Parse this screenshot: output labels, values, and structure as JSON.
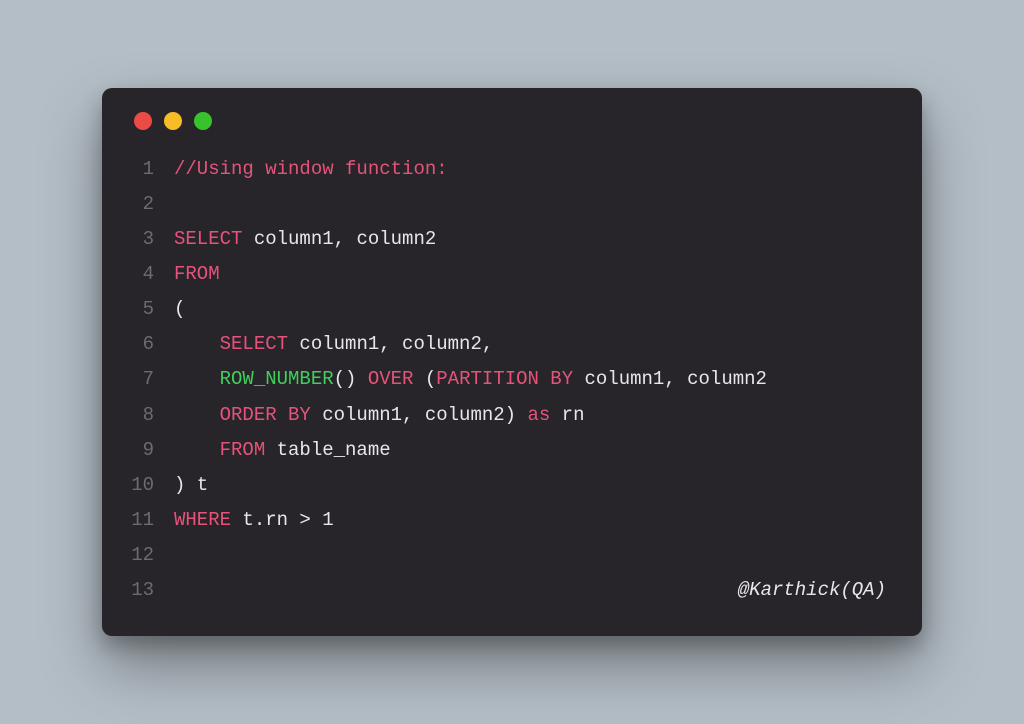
{
  "colors": {
    "close": "#eb4b45",
    "minimize": "#f6bd27",
    "zoom": "#38c22b"
  },
  "credit": "@Karthick(QA)",
  "lines": [
    {
      "n": "1",
      "tokens": [
        {
          "t": "//Using window function:",
          "c": "c-comment"
        }
      ]
    },
    {
      "n": "2",
      "tokens": []
    },
    {
      "n": "3",
      "tokens": [
        {
          "t": "SELECT",
          "c": "c-keyword"
        },
        {
          "t": " column1, column2",
          "c": "c-plain"
        }
      ]
    },
    {
      "n": "4",
      "tokens": [
        {
          "t": "FROM",
          "c": "c-keyword"
        }
      ]
    },
    {
      "n": "5",
      "tokens": [
        {
          "t": "(",
          "c": "c-plain"
        }
      ]
    },
    {
      "n": "6",
      "tokens": [
        {
          "t": "    ",
          "c": "c-plain"
        },
        {
          "t": "SELECT",
          "c": "c-keyword"
        },
        {
          "t": " column1, column2,",
          "c": "c-plain"
        }
      ]
    },
    {
      "n": "7",
      "tokens": [
        {
          "t": "    ",
          "c": "c-plain"
        },
        {
          "t": "ROW_NUMBER",
          "c": "c-func"
        },
        {
          "t": "()",
          "c": "c-plain"
        },
        {
          "t": " OVER ",
          "c": "c-over"
        },
        {
          "t": "(",
          "c": "c-plain"
        },
        {
          "t": "PARTITION BY",
          "c": "c-keyword"
        },
        {
          "t": " column1, column2",
          "c": "c-plain"
        }
      ]
    },
    {
      "n": "8",
      "tokens": [
        {
          "t": "    ",
          "c": "c-plain"
        },
        {
          "t": "ORDER BY",
          "c": "c-keyword"
        },
        {
          "t": " column1, column2) ",
          "c": "c-plain"
        },
        {
          "t": "as",
          "c": "c-as"
        },
        {
          "t": " rn",
          "c": "c-plain"
        }
      ]
    },
    {
      "n": "9",
      "tokens": [
        {
          "t": "    ",
          "c": "c-plain"
        },
        {
          "t": "FROM",
          "c": "c-keyword"
        },
        {
          "t": " table_name",
          "c": "c-plain"
        }
      ]
    },
    {
      "n": "10",
      "tokens": [
        {
          "t": ") t",
          "c": "c-plain"
        }
      ]
    },
    {
      "n": "11",
      "tokens": [
        {
          "t": "WHERE",
          "c": "c-keyword"
        },
        {
          "t": " t.rn > ",
          "c": "c-plain"
        },
        {
          "t": "1",
          "c": "c-plain"
        }
      ]
    },
    {
      "n": "12",
      "tokens": []
    },
    {
      "n": "13",
      "tokens": [],
      "credit": true
    }
  ]
}
